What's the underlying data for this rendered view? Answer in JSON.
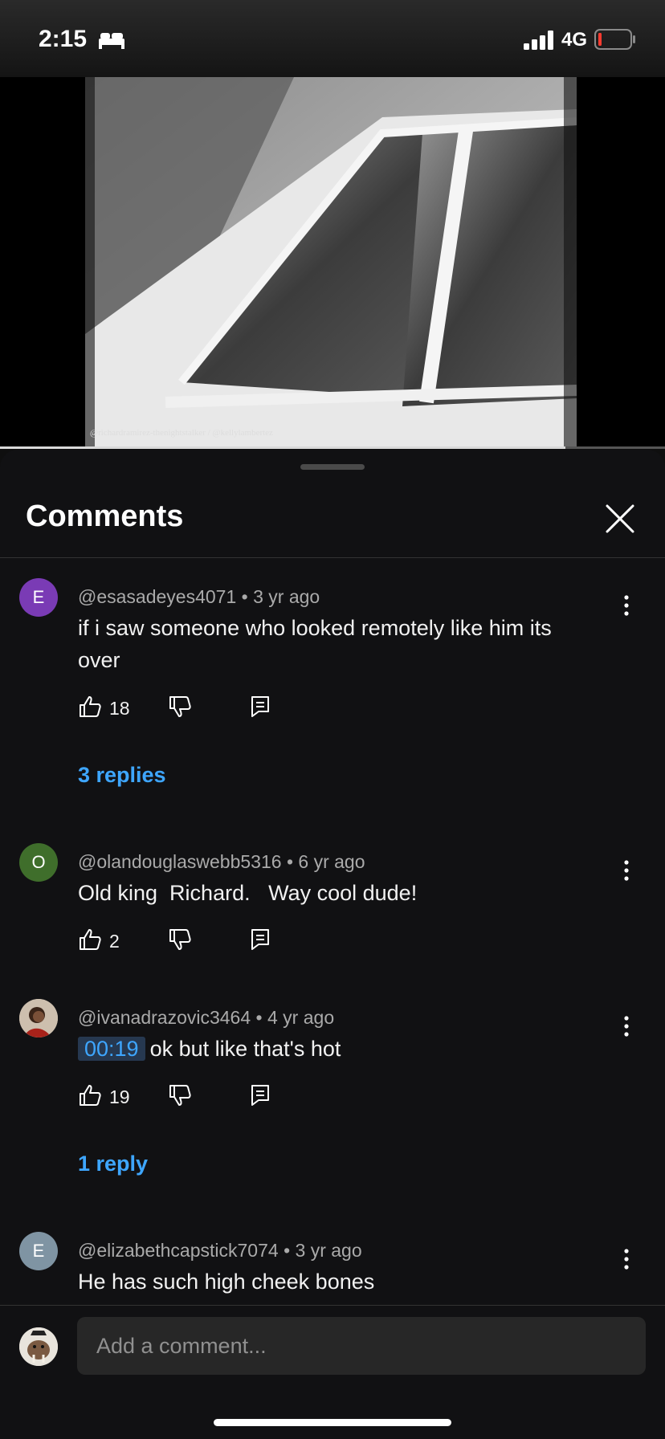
{
  "status_bar": {
    "time": "2:15",
    "network": "4G"
  },
  "video": {
    "caption": "@richardramirez-thenightstalker / @kellylambertez",
    "progress_fraction": 0.85
  },
  "sheet": {
    "title": "Comments"
  },
  "comments": [
    {
      "avatar_letter": "E",
      "avatar_color": "#7a3bb5",
      "author": "@esasadeyes4071",
      "age": "3 yr ago",
      "text": "if i saw someone who looked remotely like him its over",
      "likes": "18",
      "replies": "3 replies"
    },
    {
      "avatar_letter": "O",
      "avatar_color": "#3f6e2b",
      "author": "@olandouglaswebb5316",
      "age": "6 yr ago",
      "text": "Old king  Richard.   Way cool dude!",
      "likes": "2"
    },
    {
      "avatar_letter": "",
      "avatar_color": "#8a3b2b",
      "author": "@ivanadrazovic3464",
      "age": "4 yr ago",
      "timestamp": "00:19",
      "text": "ok but like that's hot",
      "likes": "19",
      "replies": "1 reply"
    },
    {
      "avatar_letter": "E",
      "avatar_color": "#7f94a3",
      "author": "@elizabethcapstick7074",
      "age": "3 yr ago",
      "text": "He has such high cheek bones"
    }
  ],
  "footer": {
    "input_placeholder": "Add a comment..."
  },
  "separator": "•"
}
